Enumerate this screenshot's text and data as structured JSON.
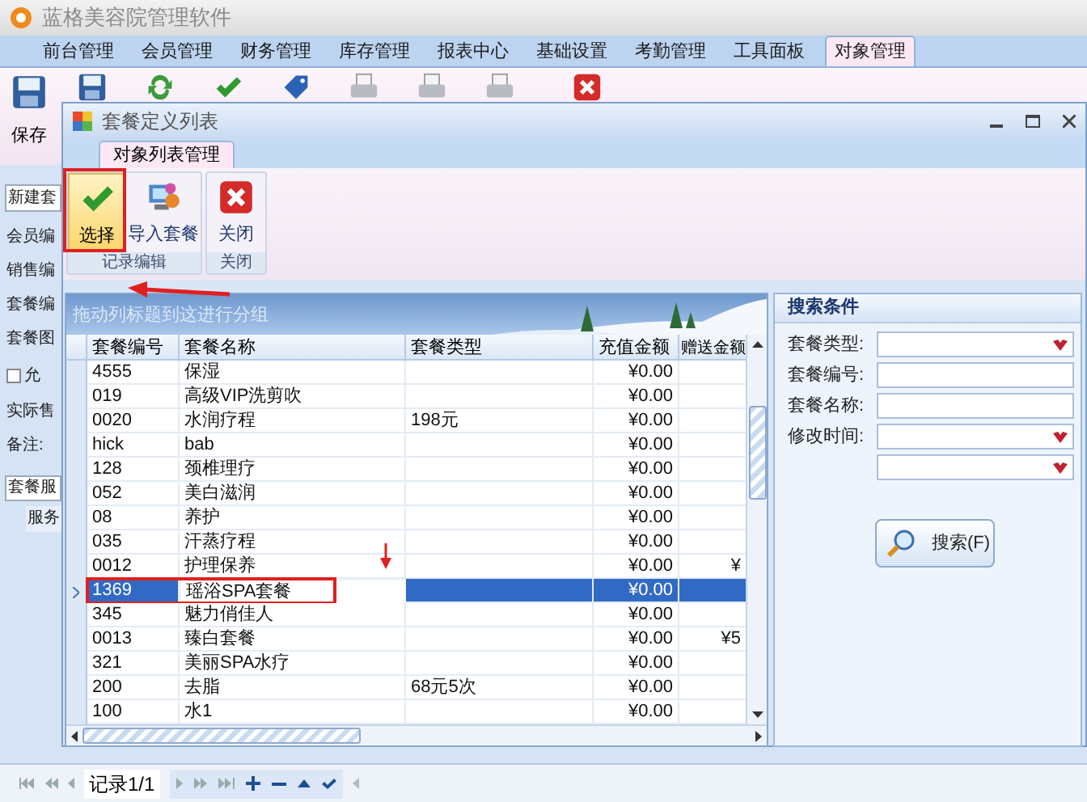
{
  "app": {
    "title": "蓝格美容院管理软件"
  },
  "main_tabs": [
    {
      "label": "前台管理",
      "selected": false
    },
    {
      "label": "会员管理",
      "selected": false
    },
    {
      "label": "财务管理",
      "selected": false
    },
    {
      "label": "库存管理",
      "selected": false
    },
    {
      "label": "报表中心",
      "selected": false
    },
    {
      "label": "基础设置",
      "selected": false
    },
    {
      "label": "考勤管理",
      "selected": false
    },
    {
      "label": "工具面板",
      "selected": false
    },
    {
      "label": "对象管理",
      "selected": true
    }
  ],
  "toolbar": {
    "save_label": "保存",
    "icons": [
      {
        "kind": "save-as"
      },
      {
        "kind": "refresh"
      },
      {
        "kind": "check"
      },
      {
        "kind": "tag"
      },
      {
        "kind": "printer"
      },
      {
        "kind": "printer"
      },
      {
        "kind": "printer"
      },
      {
        "kind": "close"
      }
    ]
  },
  "side_panel": {
    "tab": "新建套",
    "labels": [
      "会员编",
      "销售编",
      "套餐编",
      "套餐图"
    ],
    "checkbox": {
      "label": "允",
      "checked": false
    },
    "labels_after": [
      "实际售",
      "备注:"
    ],
    "bottom_tab": "套餐服",
    "column": "服务"
  },
  "dialog": {
    "title": "套餐定义列表",
    "ribbon_tabs": [
      {
        "label": "对象列表管理",
        "selected": true
      }
    ],
    "groups": [
      {
        "label": "记录编辑",
        "buttons": [
          {
            "label": "选择",
            "kind": "check",
            "selected": true
          },
          {
            "label": "导入套餐",
            "kind": "import",
            "selected": false
          }
        ]
      },
      {
        "label": "关闭",
        "buttons": [
          {
            "label": "关闭",
            "kind": "close",
            "selected": false
          }
        ]
      }
    ]
  },
  "grid": {
    "group_hint": "拖动列标题到这进行分组",
    "columns": [
      "套餐编号",
      "套餐名称",
      "套餐类型",
      "充值金额",
      "赠送金额"
    ],
    "rows": [
      {
        "cells": [
          "4555",
          "保湿",
          "",
          "¥0.00",
          ""
        ],
        "selected": false
      },
      {
        "cells": [
          "019",
          "高级VIP洗剪吹",
          "",
          "¥0.00",
          ""
        ],
        "selected": false
      },
      {
        "cells": [
          "0020",
          "水润疗程",
          "198元",
          "¥0.00",
          ""
        ],
        "selected": false
      },
      {
        "cells": [
          "hick",
          "bab",
          "",
          "¥0.00",
          ""
        ],
        "selected": false
      },
      {
        "cells": [
          "128",
          "颈椎理疗",
          "",
          "¥0.00",
          ""
        ],
        "selected": false
      },
      {
        "cells": [
          "052",
          "美白滋润",
          "",
          "¥0.00",
          ""
        ],
        "selected": false
      },
      {
        "cells": [
          "08",
          "养护",
          "",
          "¥0.00",
          ""
        ],
        "selected": false
      },
      {
        "cells": [
          "035",
          "汗蒸疗程",
          "",
          "¥0.00",
          ""
        ],
        "selected": false
      },
      {
        "cells": [
          "0012",
          "护理保养",
          "",
          "¥0.00",
          "¥"
        ],
        "selected": false
      },
      {
        "cells": [
          "1369",
          "瑶浴SPA套餐",
          "",
          "¥0.00",
          ""
        ],
        "selected": true
      },
      {
        "cells": [
          "345",
          "魅力俏佳人",
          "",
          "¥0.00",
          ""
        ],
        "selected": false
      },
      {
        "cells": [
          "0013",
          "臻白套餐",
          "",
          "¥0.00",
          "¥5"
        ],
        "selected": false
      },
      {
        "cells": [
          "321",
          "美丽SPA水疗",
          "",
          "¥0.00",
          ""
        ],
        "selected": false
      },
      {
        "cells": [
          "200",
          "去脂",
          "68元5次",
          "¥0.00",
          ""
        ],
        "selected": false
      },
      {
        "cells": [
          "100",
          "水1",
          "",
          "¥0.00",
          ""
        ],
        "selected": false
      }
    ]
  },
  "search": {
    "title": "搜索条件",
    "fields": [
      {
        "label": "套餐类型:",
        "kind": "dropdown"
      },
      {
        "label": "套餐编号:",
        "kind": "text"
      },
      {
        "label": "套餐名称:",
        "kind": "text"
      },
      {
        "label": "修改时间:",
        "kind": "dropdown"
      },
      {
        "kind": "dropdown"
      }
    ],
    "button": "搜索(F)"
  },
  "pager": {
    "record": "记录1/1"
  }
}
